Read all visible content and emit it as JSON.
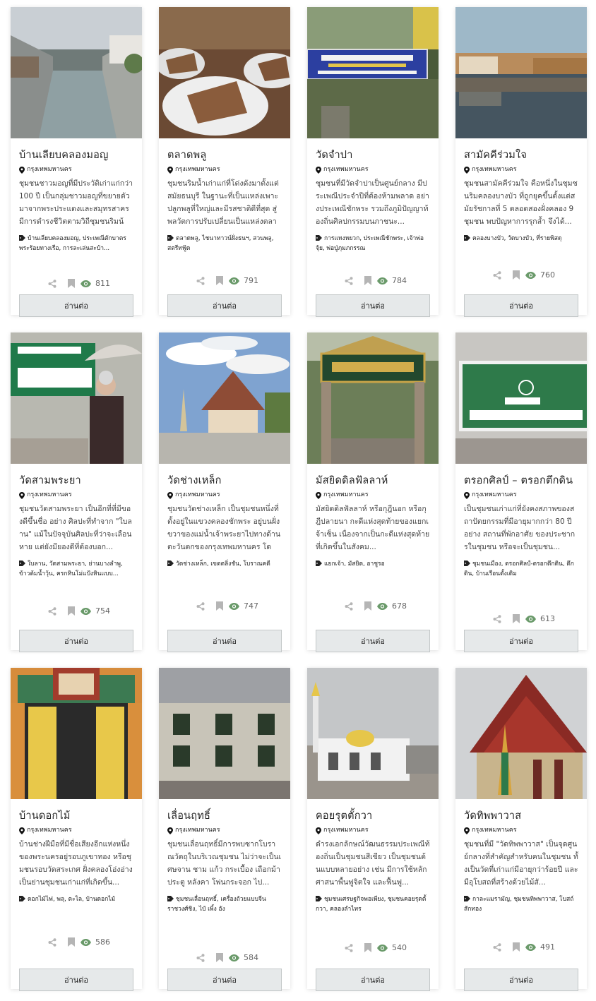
{
  "cards": [
    {
      "title": "บ้านเลียบคลองมอญ",
      "location": "กรุงเทพมหานคร",
      "excerpt": "ชุมชนชาวมอญที่มีประวัติเก่าแก่กว่า 100 ปี เป็นกลุ่มชาวมอญที่ขยายตัวมาจากพระประแดงและสมุทรสาคร มีการดำรงชีวิตตามวิถีชุมชนริมน้ำ...",
      "tags": "บ้านเลียบคลองมอญ, ประเพณีตักบาตรพระร้อยทางเรือ, การละเล่นสะบ้า...",
      "views": "811",
      "button": "อ่านต่อ"
    },
    {
      "title": "ตลาดพลู",
      "location": "กรุงเทพมหานคร",
      "excerpt": "ชุมชนริมน้ำเก่าแก่ที่โด่งดังมาตั้งแต่สมัยธนบุรี ในฐานะที่เป็นแหล่งเพาะปลูกพลูที่ใหญ่และมีรสชาติดีที่สุด สู่พลวัตการปรับเปลี่ยนเป็นแหล่งตลาด...",
      "tags": "ตลาดพลู, ไชนาทาวน์ฝั่งธนฯ, สวนพลู, สตรีทฟู้ด",
      "views": "791",
      "button": "อ่านต่อ"
    },
    {
      "title": "วัดจำปา",
      "location": "กรุงเทพมหานคร",
      "excerpt": "ชุมชนที่มีวัดจำปาเป็นศูนย์กลาง มีประเพณีประจำปีที่ต้องห้ามพลาด อย่างประเพณีชักพระ รวมถึงภูมิปัญญาท้องถิ่นศิลปกรรมบนภาชนะ...",
      "tags": "การแทงหยวก, ประเพณีชักพระ, เจ้าพ่อจุ้ย, พ่อปู่ภุมภกรรณ",
      "views": "784",
      "button": "อ่านต่อ"
    },
    {
      "title": "สามัคคีร่วมใจ",
      "location": "กรุงเทพมหานคร",
      "excerpt": "ชุมชนสามัคคีร่วมใจ คือหนึ่งในชุมชนริมคลองบางบัว ที่ถูกยุคขึ้นตั้งแต่สมัยรัชกาลที่ 5 ตลอดสองฝั่งคลอง 9 ชุมชน พบปัญหาการรุกล้ำ จึงได้...",
      "tags": "คลองบางบัว, วัดบางบัว, ที่รายพิสดุ",
      "views": "760",
      "button": "อ่านต่อ"
    },
    {
      "title": "วัดสามพระยา",
      "location": "กรุงเทพมหานคร",
      "excerpt": "ชุมชนวัดสามพระยา เป็นอีกที่ที่มีของดีขึ้นชื่อ อย่าง ศิลปะที่ทำจาก \"ใบลาน\" แม้ในปัจจุบันศิลปะที่ว่าจะเลือนหาย แต่ยังมียองดีที่ต้องบอก...",
      "tags": "ใบลาน, วัดสามพระยา, ย่านบางลำพู, ข้าวต้มน้ำวุ้น, ครกหินโม่แป้งหินแบบ...",
      "views": "754",
      "button": "อ่านต่อ"
    },
    {
      "title": "วัดช่างเหล็ก",
      "location": "กรุงเทพมหานคร",
      "excerpt": "ชุมชนวัดช่างเหล็ก เป็นชุมชนหนึ่งที่ตั้งอยู่ในแขวงคลองชักพระ อยู่บนฝั่งขวาของแม่น้ำเจ้าพระยาไปทางด้านตะวันตกของกรุงเทพมหานคร โดย...",
      "tags": "วัดช่างเหล็ก, เขตตลิ่งชัน, โบราณคดี",
      "views": "747",
      "button": "อ่านต่อ"
    },
    {
      "title": "มัสยิดดิลฟัลลาห์",
      "location": "กรุงเทพมหานคร",
      "excerpt": "มัสยิดดิลฟัลลาห์ หรือกุฎีนอก หรือกุฎีปลายนา กะดีแห่งสุดท้ายของแยกเจ้าเซ็น เนื่องจากเป็นกะดีแห่งสุดท้ายที่เกิดขึ้นในสังคม...",
      "tags": "แยกเจ้า, มัสยิด, อาชูรอ",
      "views": "678",
      "button": "อ่านต่อ"
    },
    {
      "title": "ตรอกศิลป์ – ตรอกตึกดิน",
      "location": "กรุงเทพมหานคร",
      "excerpt": "เป็นชุมชนเก่าแก่ที่ยังคงสภาพของสถาปัตยกรรมที่มีอายุมากกว่า 80 ปี อย่าง สถานที่พักอาศัย ของประชากรในชุมชน หรือจะเป็นชุมชน...",
      "tags": "ชุมชนเมือง, ตรอกศิลป์-ตรอกตึกดิน, ตึกดิน, บ้านเรือนดั้งเดิม",
      "views": "613",
      "button": "อ่านต่อ"
    },
    {
      "title": "บ้านดอกไม้",
      "location": "กรุงเทพมหานคร",
      "excerpt": "บ้านช่างฝีมือที่มีชื่อเสียงอีกแห่งหนึ่งของพระนครอยู่รอบภูเขาทอง หรือชุมชนรอบวัดสระเกศ ฝั่งคลองโอ่งอ่าง เป็นย่านชุมชนเก่าแก่ที่เกิดขึ้น...",
      "tags": "ดอกไม้ไฟ, พลุ, ตะไล, บ้านดอกไม้",
      "views": "586",
      "button": "อ่านต่อ"
    },
    {
      "title": "เลื่อนฤทธิ์",
      "location": "กรุงเทพมหานคร",
      "excerpt": "ชุมชนเลื่อนฤทธิ์มีการพบซากโบราณวัตถุในบริเวณชุมชน ไม่ว่าจะเป็นเศษจาน ชาม แก้ว กระเบื้อง เถือกม้าประตู หลังคา โพ่นกระจอก ไป...",
      "tags": "ชุมชนเลื่อนฤทธิ์, เครื่องถ้วยแบบจีน ราชวงศ์ชิง, ไป๋ เพิ้ง อัง",
      "views": "584",
      "button": "อ่านต่อ"
    },
    {
      "title": "คอยรุตตั้กวา",
      "location": "กรุงเทพมหานคร",
      "excerpt": "ดำรงเอกลักษณ์วัฒนธรรมประเพณีท้องถิ่นเป็นชุมชนสีเขียว เป็นชุมชนต้นแบบหลายอย่าง เช่น มีการใช้หลักศาสนาพื้นฟูจิตใจ และฟื้นฟู...",
      "tags": "ชุมชนเศรษฐกิจพอเพียง, ชุมชนคอยรุตตั้กวา, คลองลำไทร",
      "views": "540",
      "button": "อ่านต่อ"
    },
    {
      "title": "วัดทิพพาวาส",
      "location": "กรุงเทพมหานคร",
      "excerpt": "ชุมชนที่มี \"วัดทิพพาวาส\" เป็นจุดศูนย์กลางที่สำคัญสำหรับคนในชุมชน ทั้งเป็นวัดที่เก่าแก่มีอายุกว่าร้อยปี และมีอุโบสถที่สร้างด้วยไม้สั...",
      "tags": "กาละแมรามัญ, ชุมชนทิพพาวาส, โบสถ์สักทอง",
      "views": "491",
      "button": "อ่านต่อ"
    }
  ]
}
